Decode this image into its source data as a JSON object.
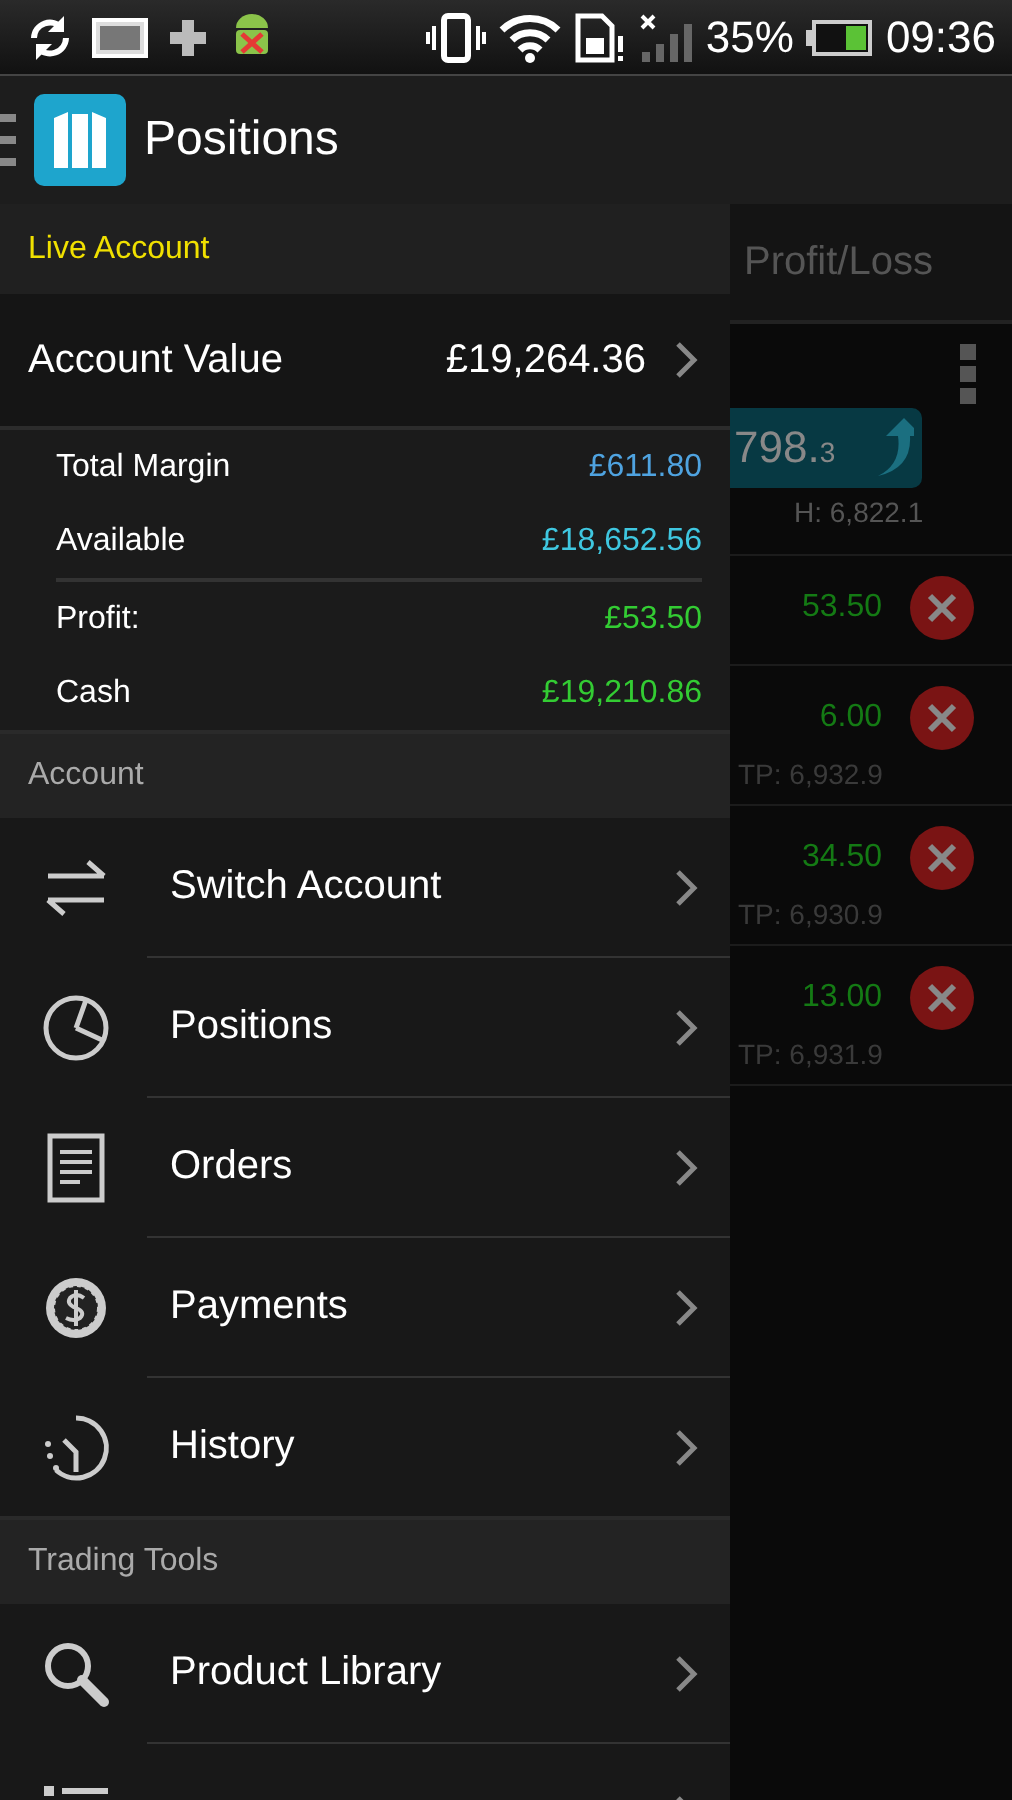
{
  "status_bar": {
    "battery_text": "35%",
    "time": "09:36"
  },
  "action_bar": {
    "title": "Positions"
  },
  "drawer": {
    "header": "Live Account",
    "account_value": {
      "label": "Account Value",
      "value": "£19,264.36"
    },
    "details": [
      {
        "label": "Total Margin",
        "value": "£611.80",
        "color": "#4fa3e0"
      },
      {
        "label": "Available",
        "value": "£18,652.56",
        "color": "#3fc7e0"
      },
      {
        "label": "Profit:",
        "value": "£53.50",
        "color": "#33cc33"
      },
      {
        "label": "Cash",
        "value": "£19,210.86",
        "color": "#33cc33"
      }
    ],
    "sections": [
      {
        "title": "Account",
        "items": [
          {
            "kind": "full",
            "label": "Switch Account"
          },
          {
            "kind": "full",
            "label": "Positions"
          },
          {
            "kind": "full",
            "label": "Orders"
          },
          {
            "kind": "full",
            "label": "Payments"
          },
          {
            "kind": "full",
            "label": "History"
          }
        ]
      },
      {
        "title": "Trading Tools",
        "items": [
          {
            "kind": "full",
            "label": "Product Library"
          },
          {
            "kind": "cut"
          }
        ]
      }
    ]
  },
  "background": {
    "column_header": "Profit/Loss",
    "price_main": "798.",
    "price_small": "3",
    "high": "H: 6,822.1",
    "rows": [
      {
        "value": "53.50"
      },
      {
        "value": "6.00",
        "tp": "TP: 6,932.9"
      },
      {
        "value": "34.50",
        "tp": "TP: 6,930.9"
      },
      {
        "value": "13.00",
        "tp": "TP: 6,931.9"
      }
    ]
  }
}
